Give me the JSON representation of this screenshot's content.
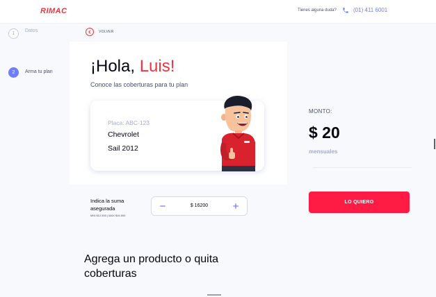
{
  "header": {
    "logo_text": "RIMAC",
    "help_text": "Tienes alguna duda?",
    "phone_icon": "phone-icon",
    "phone_number": "(01) 411 6001",
    "brand_color": "#ef3340",
    "accent_color": "#6f7dff"
  },
  "steps": [
    {
      "number": "1",
      "label": "Datos",
      "active": false
    },
    {
      "number": "2",
      "label": "Arma tu plan",
      "active": true
    }
  ],
  "back": {
    "icon": "chevron-left-icon",
    "label": "VOLVER"
  },
  "card": {
    "greeting_prefix": "¡Hola, ",
    "greeting_name": "Luis!",
    "subtitle": "Conoce las coberturas para tu plan",
    "plate_label": "Placa: ABC-123",
    "car_brand": "Chevrolet",
    "car_model": "Sail 2012",
    "mascot_icon": "mascot-illustration"
  },
  "insured": {
    "label": "Indica la suma asegurada",
    "range": "MIN $12.500 | MAX $16.500",
    "minus_icon": "minus-icon",
    "plus_icon": "plus-icon",
    "value": "$ 16200"
  },
  "summary": {
    "label": "MONTO:",
    "amount": "$ 20",
    "period": "mensuales",
    "cta_label": "LO QUIERO",
    "cta_color": "#ff1c44"
  },
  "section": {
    "title": "Agrega un producto o quita coberturas"
  }
}
